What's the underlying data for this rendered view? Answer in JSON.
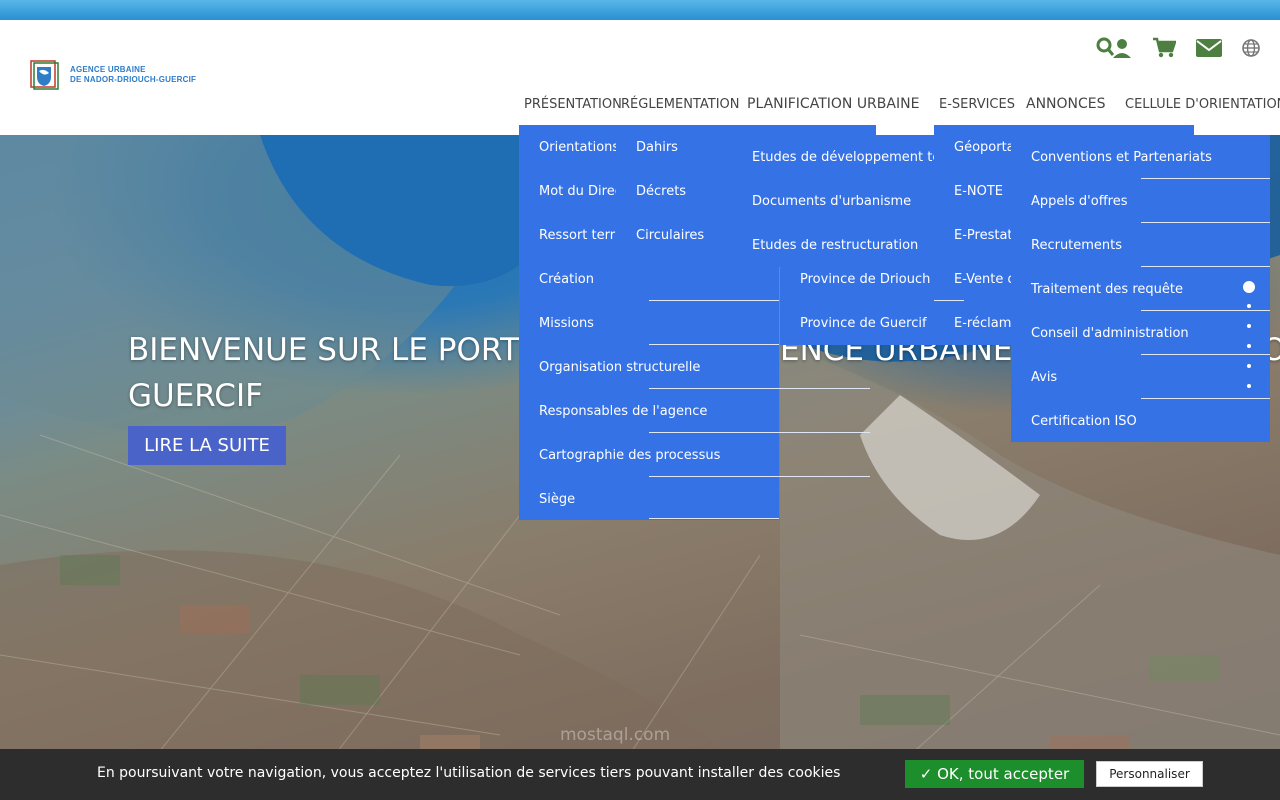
{
  "site": {
    "logo_line1": "AGENCE URBAINE",
    "logo_line2": "DE NADOR-DRIOUCH-GUERCIF"
  },
  "header_icons": [
    "search-user-icon",
    "cart-icon",
    "envelope-icon",
    "globe-icon"
  ],
  "nav": [
    "PRÉSENTATION",
    "RÉGLEMENTATION",
    "PLANIFICATION URBAINE",
    "E-SERVICES",
    "ANNONCES",
    "CELLULE D'ORIENTATION"
  ],
  "hero": {
    "title_line1_left": "BIENVENUE SUR LE PORT",
    "title_line1_right": "ENCE URBAINE",
    "title_line1_end": "O",
    "title_line2": "GUERCIF",
    "button": "LIRE LA SUITE"
  },
  "menus": {
    "presentation": [
      "Orientations",
      "Mot du Direct",
      "Ressort territ",
      "Création",
      "Missions",
      "Organisation structurelle",
      "Responsables de l'agence",
      "Cartographie des processus",
      "Siège"
    ],
    "reglementation": [
      "Dahirs",
      "Décrets",
      "Circulaires"
    ],
    "planification": [
      "Etudes de développement terri",
      "Documents d'urbanisme",
      "Etudes de restructuration"
    ],
    "provinces": [
      "Province de Driouch",
      "Province de Guercif"
    ],
    "eservices": [
      "Géoportai",
      "E-NOTE",
      "E-Prestat",
      "E-Vente d",
      "E-réclama"
    ],
    "annonces": [
      "Conventions et Partenariats",
      "Appels d'offres",
      "Recrutements",
      "Traitement des requête",
      "Conseil d'administration",
      "Avis",
      "Certification ISO"
    ]
  },
  "cookie": {
    "text": "En poursuivant votre navigation, vous acceptez l'utilisation de services tiers pouvant installer des cookies",
    "accept": "✓ OK, tout accepter",
    "customize": "Personnaliser"
  },
  "watermark": "mostaql.com",
  "colors": {
    "menu_blue": "#3572e6",
    "button_blue": "#4a63c9",
    "accept_green": "#1c8f2c",
    "icon_green": "#4d8040"
  }
}
